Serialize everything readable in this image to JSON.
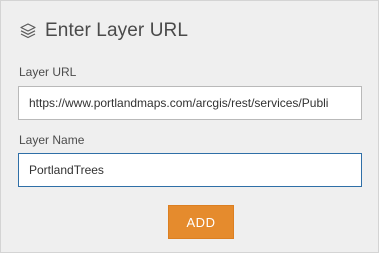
{
  "header": {
    "icon": "layers-icon",
    "title": "Enter Layer URL"
  },
  "layer_url": {
    "label": "Layer URL",
    "value": "https://www.portlandmaps.com/arcgis/rest/services/Publi"
  },
  "layer_name": {
    "label": "Layer Name",
    "value": "PortlandTrees"
  },
  "add_button": {
    "label": "ADD",
    "color": "#e58b2d"
  },
  "colors": {
    "panel_background": "#efefef",
    "focus_border": "#2f6fa7"
  }
}
